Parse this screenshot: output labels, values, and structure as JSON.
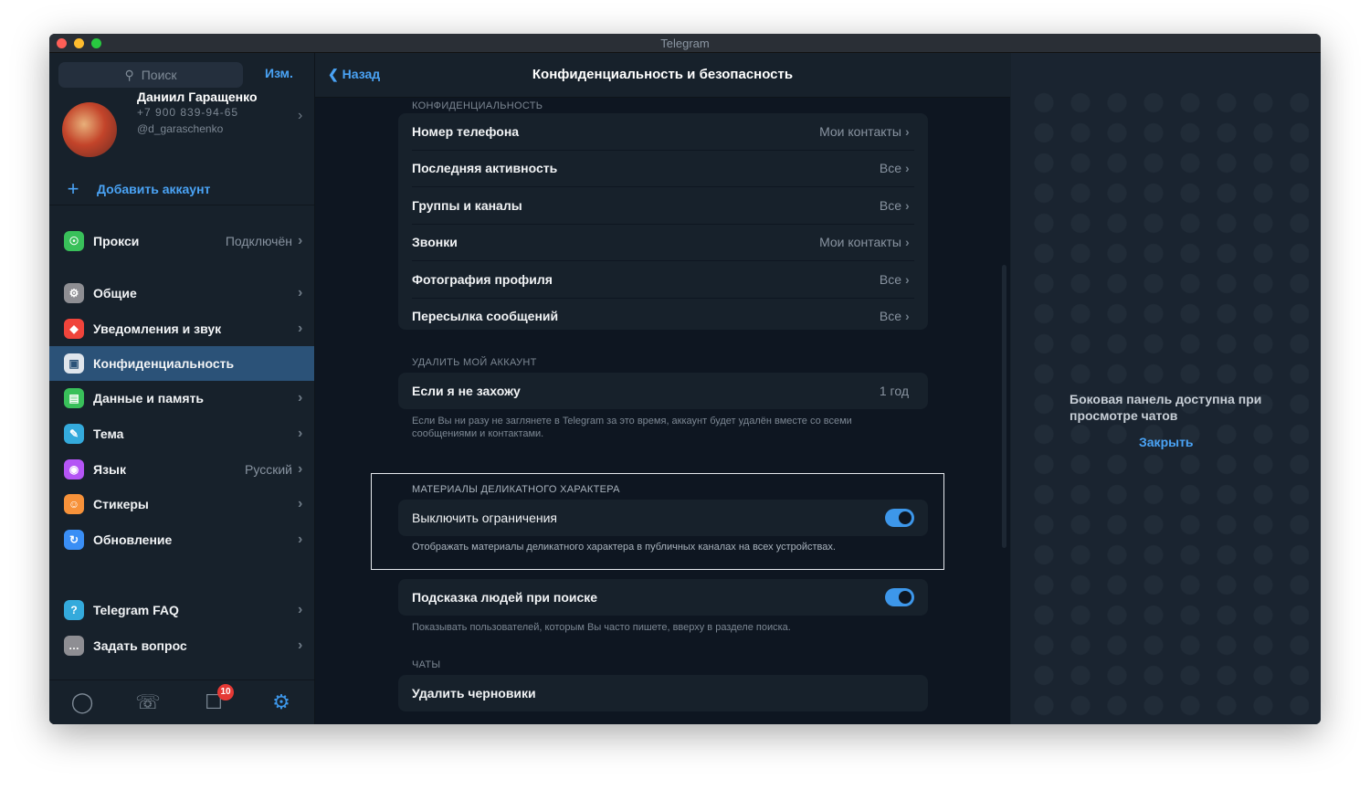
{
  "window": {
    "title": "Telegram"
  },
  "left": {
    "search_placeholder": "Поиск",
    "edit_label": "Изм.",
    "profile": {
      "name": "Даниил Гаращенко",
      "phone": "+7 900 839-94-65",
      "username": "@d_garaschenko"
    },
    "add_account_label": "Добавить аккаунт",
    "menu": [
      {
        "label": "Прокси",
        "value": "Подключён",
        "color": "#39c05a",
        "icon": "shield-icon"
      },
      {
        "label": "Общие",
        "value": "",
        "color": "#8e8e93",
        "icon": "gear-icon"
      },
      {
        "label": "Уведомления и звук",
        "value": "",
        "color": "#f0443b",
        "icon": "bell-icon"
      },
      {
        "label": "Конфиденциальность",
        "value": "",
        "color": "#5a6a7a",
        "icon": "lock-icon"
      },
      {
        "label": "Данные и память",
        "value": "",
        "color": "#39c05a",
        "icon": "database-icon"
      },
      {
        "label": "Тема",
        "value": "",
        "color": "#34aadc",
        "icon": "brush-icon"
      },
      {
        "label": "Язык",
        "value": "Русский",
        "color": "#b455f5",
        "icon": "globe-icon"
      },
      {
        "label": "Стикеры",
        "value": "",
        "color": "#f7923a",
        "icon": "sticker-icon"
      },
      {
        "label": "Обновление",
        "value": "",
        "color": "#3a8ef5",
        "icon": "refresh-icon"
      },
      {
        "label": "Telegram FAQ",
        "value": "",
        "color": "#34aadc",
        "icon": "question-icon"
      },
      {
        "label": "Задать вопрос",
        "value": "",
        "color": "#8e8e93",
        "icon": "chat-icon"
      }
    ],
    "badge_count": "10"
  },
  "middle": {
    "back_label": "Назад",
    "title": "Конфиденциальность и безопасность",
    "privacy_section": "КОНФИДЕНЦИАЛЬНОСТЬ",
    "privacy_rows": [
      {
        "label": "Номер телефона",
        "value": "Мои контакты"
      },
      {
        "label": "Последняя активность",
        "value": "Все"
      },
      {
        "label": "Группы и каналы",
        "value": "Все"
      },
      {
        "label": "Звонки",
        "value": "Мои контакты"
      },
      {
        "label": "Фотография профиля",
        "value": "Все"
      },
      {
        "label": "Пересылка сообщений",
        "value": "Все"
      }
    ],
    "delete_section": "УДАЛИТЬ МОЙ АККАУНТ",
    "delete_row": {
      "label": "Если я не захожу",
      "value": "1 год"
    },
    "delete_note": "Если Вы ни разу не заглянете в Telegram за это время, аккаунт будет удалён вместе со всеми сообщениями и контактами.",
    "sensitive_section": "МАТЕРИАЛЫ ДЕЛИКАТНОГО ХАРАКТЕРА",
    "sensitive_row": {
      "label": "Выключить ограничения",
      "enabled": true
    },
    "sensitive_note": "Отображать материалы деликатного характера в публичных каналах на всех устройствах.",
    "suggest_row": {
      "label": "Подсказка людей при поиске",
      "enabled": true
    },
    "suggest_note": "Показывать пользователей, которым Вы часто пишете, вверху в разделе поиска.",
    "chats_section": "ЧАТЫ",
    "chats_row": {
      "label": "Удалить черновики"
    }
  },
  "right": {
    "message": "Боковая панель доступна при просмотре чатов",
    "close_label": "Закрыть"
  },
  "colors": {
    "accent": "#4aa3f5",
    "toggle": "#3d97ea",
    "active_bg": "#2b5278"
  }
}
